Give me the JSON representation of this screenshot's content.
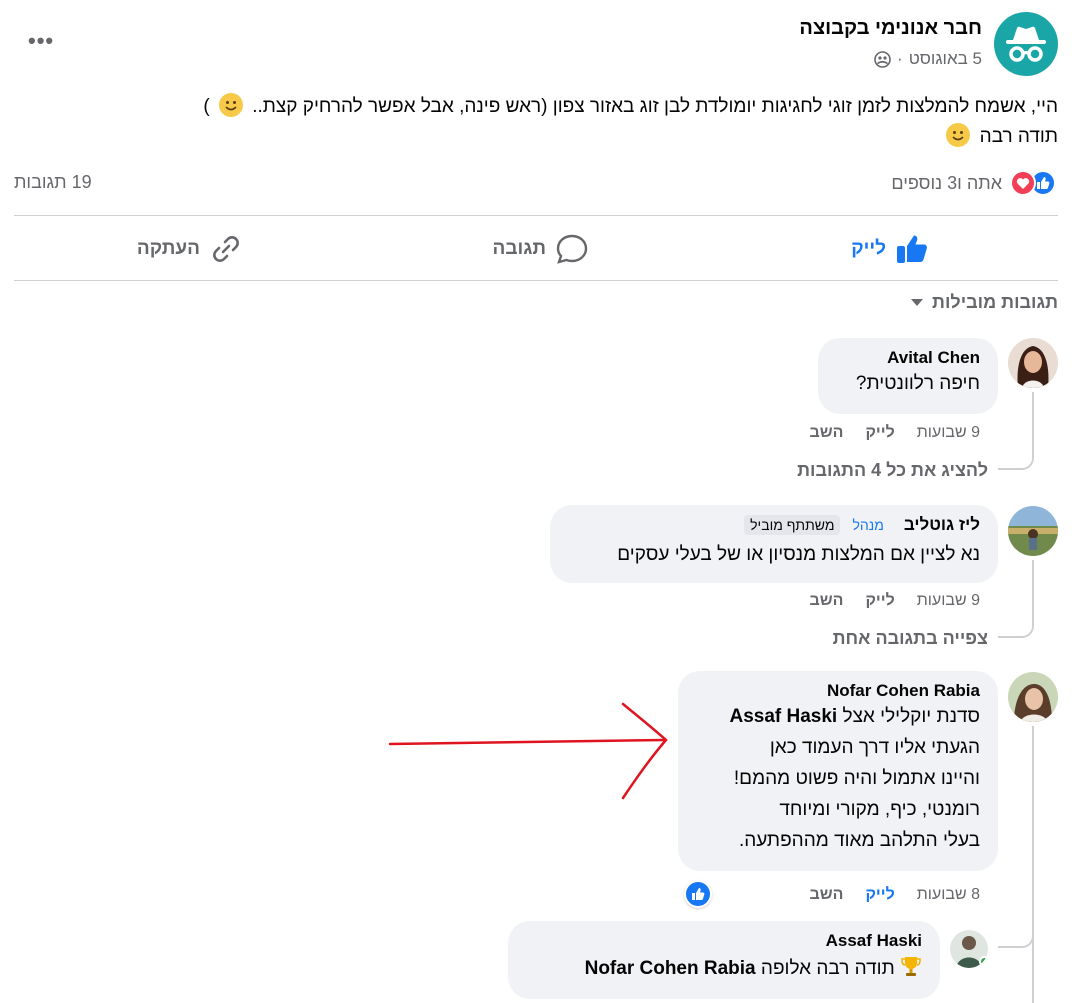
{
  "post": {
    "author": "חבר אנונימי בקבוצה",
    "date": "5 באוגוסט",
    "separator": "·",
    "privacy_icon": "group-privacy-icon",
    "line1": "היי, אשמח להמלצות לזמן זוגי לחגיגות יומולדת לבן זוג באזור צפון (ראש פינה, אבל אפשר להרחיק קצת..",
    "line1_suffix": ")",
    "line2": "תודה רבה",
    "more_label": "•••"
  },
  "reactions": {
    "summary": "אתה ו3 נוספים",
    "comments_count": "19 תגובות",
    "icons": [
      "like-icon",
      "love-icon"
    ]
  },
  "actions": {
    "like": "לייק",
    "comment": "תגובה",
    "share": "העתקה"
  },
  "sort": {
    "label": "תגובות מובילות"
  },
  "comments": [
    {
      "name": "Avital Chen",
      "text": "חיפה רלוונטית?",
      "time": "9 שבועות",
      "like": "לייק",
      "reply": "השב",
      "view_replies": "להציג את כל 4 התגובות"
    },
    {
      "name": "ליז גוטליב",
      "badge_admin": "מנהל",
      "badge_top": "משתתף מוביל",
      "text": "נא לציין אם המלצות מנסיון או של בעלי עסקים",
      "time": "9 שבועות",
      "like": "לייק",
      "reply": "השב",
      "view_replies": "צפייה בתגובה אחת"
    },
    {
      "name": "Nofar Cohen Rabia",
      "lines": [
        "סדנת יוקלילי אצל",
        "הגעתי אליו דרך העמוד כאן",
        "והיינו אתמול והיה פשוט מהמם!",
        "רומנטי, כיף, מקורי ומיוחד",
        "בעלי התלהב מאוד מההפתעה."
      ],
      "mention": "Assaf Haski",
      "time": "8 שבועות",
      "like": "לייק",
      "reply": "השב"
    }
  ],
  "reply": {
    "name": "Assaf Haski",
    "text": "תודה רבה אלופה",
    "mention": "Nofar Cohen Rabia"
  },
  "colors": {
    "accent": "#1877f2",
    "secondary_text": "#65676b",
    "bubble": "#f0f2f5",
    "arrow": "#e0141e"
  }
}
